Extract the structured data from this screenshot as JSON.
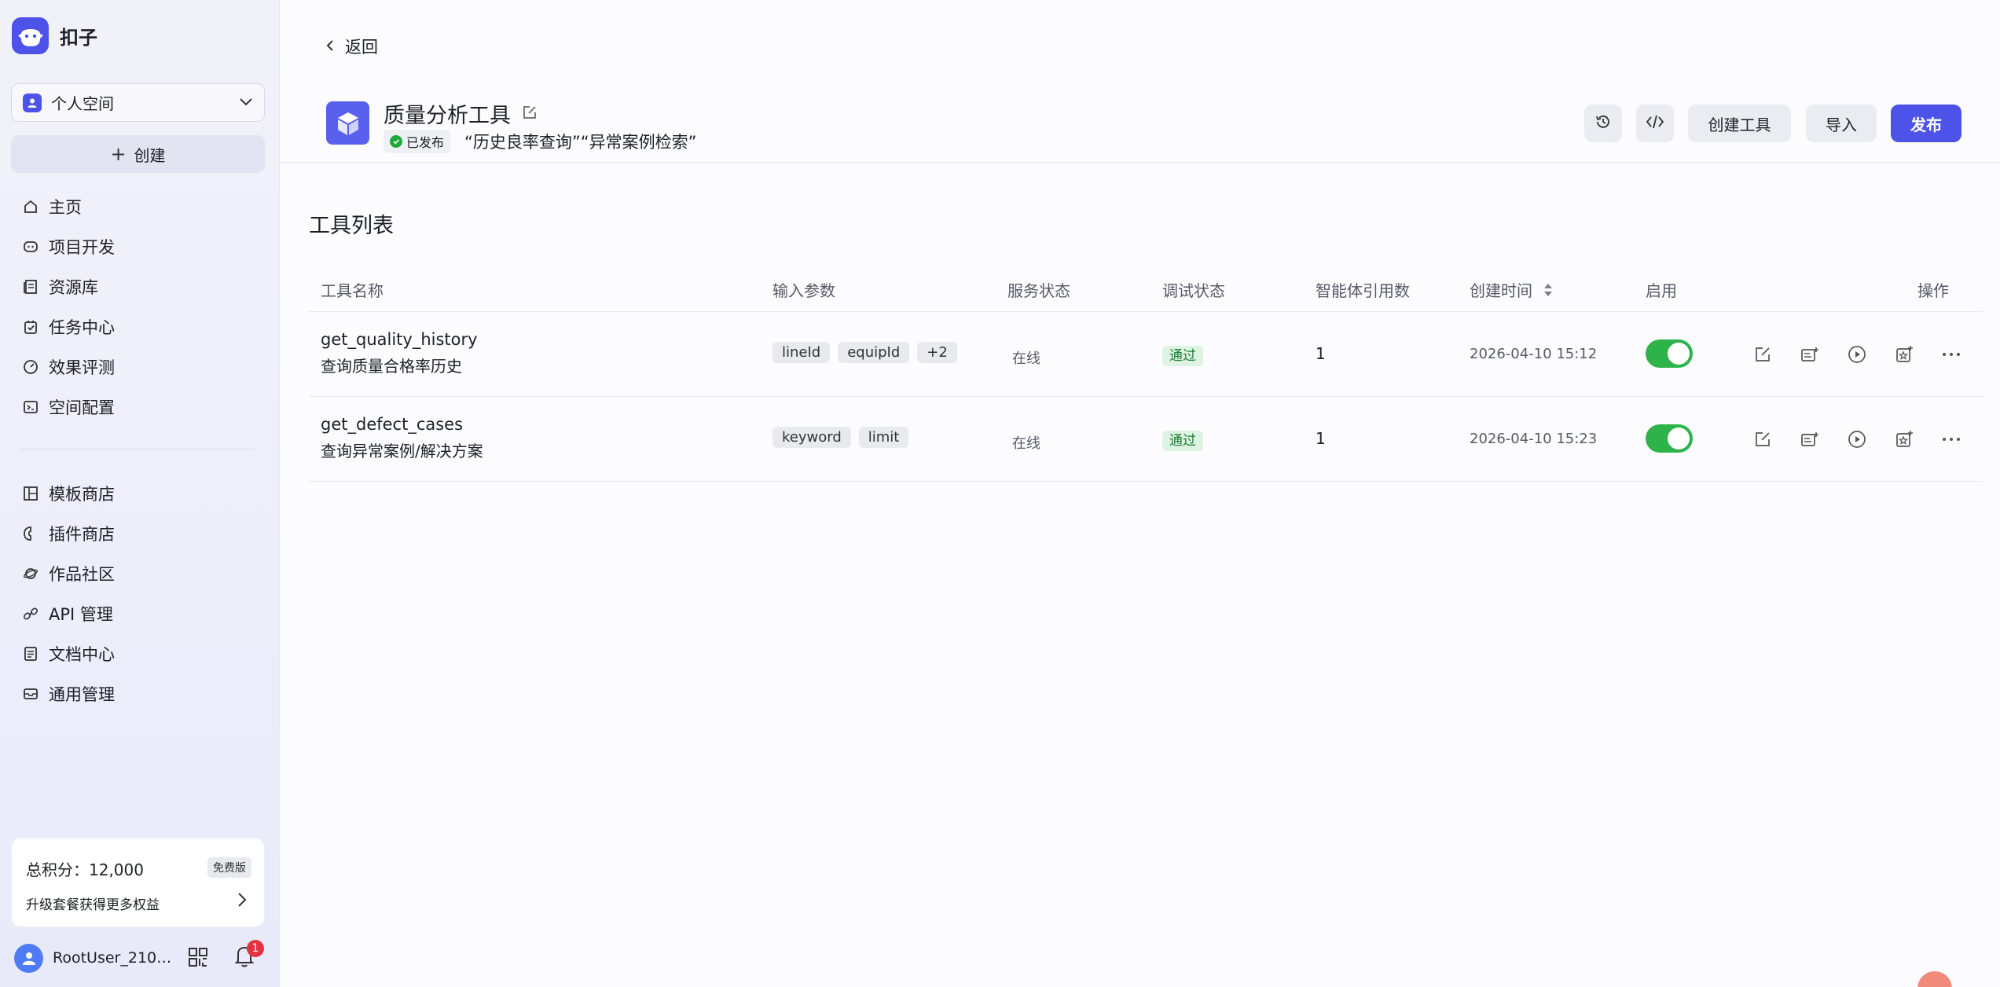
{
  "app": {
    "name": "扣子"
  },
  "sidebar": {
    "space": "个人空间",
    "create_label": "创建",
    "nav_primary": [
      {
        "label": "主页",
        "icon": "home-icon"
      },
      {
        "label": "项目开发",
        "icon": "project-icon"
      },
      {
        "label": "资源库",
        "icon": "library-icon"
      },
      {
        "label": "任务中心",
        "icon": "task-icon"
      },
      {
        "label": "效果评测",
        "icon": "gauge-icon"
      },
      {
        "label": "空间配置",
        "icon": "config-icon"
      }
    ],
    "nav_secondary": [
      {
        "label": "模板商店",
        "icon": "template-icon"
      },
      {
        "label": "插件商店",
        "icon": "plugin-store-icon"
      },
      {
        "label": "作品社区",
        "icon": "planet-icon"
      },
      {
        "label": "API 管理",
        "icon": "link-icon"
      },
      {
        "label": "文档中心",
        "icon": "doc-icon"
      },
      {
        "label": "通用管理",
        "icon": "inbox-icon"
      }
    ],
    "credits": {
      "total": "总积分：12,000",
      "plan_badge": "免费版",
      "upgrade": "升级套餐获得更多权益"
    },
    "user": {
      "name": "RootUser_210…",
      "notifications": "1"
    }
  },
  "header": {
    "back_label": "返回",
    "plugin_name": "质量分析工具",
    "status": "已发布",
    "description": "“历史良率查询”“异常案例检索”",
    "buttons": {
      "create_tool": "创建工具",
      "import": "导入",
      "publish": "发布"
    }
  },
  "table": {
    "title": "工具列表",
    "columns": [
      "工具名称",
      "输入参数",
      "服务状态",
      "调试状态",
      "智能体引用数",
      "创建时间",
      "启用",
      "操作"
    ],
    "rows": [
      {
        "name": "get_quality_history",
        "desc": "查询质量合格率历史",
        "params": [
          "lineId",
          "equipId",
          "+2"
        ],
        "service": "在线",
        "debug": "通过",
        "refs": "1",
        "created": "2026-04-10 15:12",
        "enabled": true
      },
      {
        "name": "get_defect_cases",
        "desc": "查询异常案例/解决方案",
        "params": [
          "keyword",
          "limit"
        ],
        "service": "在线",
        "debug": "通过",
        "refs": "1",
        "created": "2026-04-10 15:23",
        "enabled": true
      }
    ]
  },
  "colors": {
    "accent": "#4d53e8",
    "toggle_on": "#2db34a",
    "pass_bg": "#dff3e3",
    "badge": "#e5323f"
  }
}
